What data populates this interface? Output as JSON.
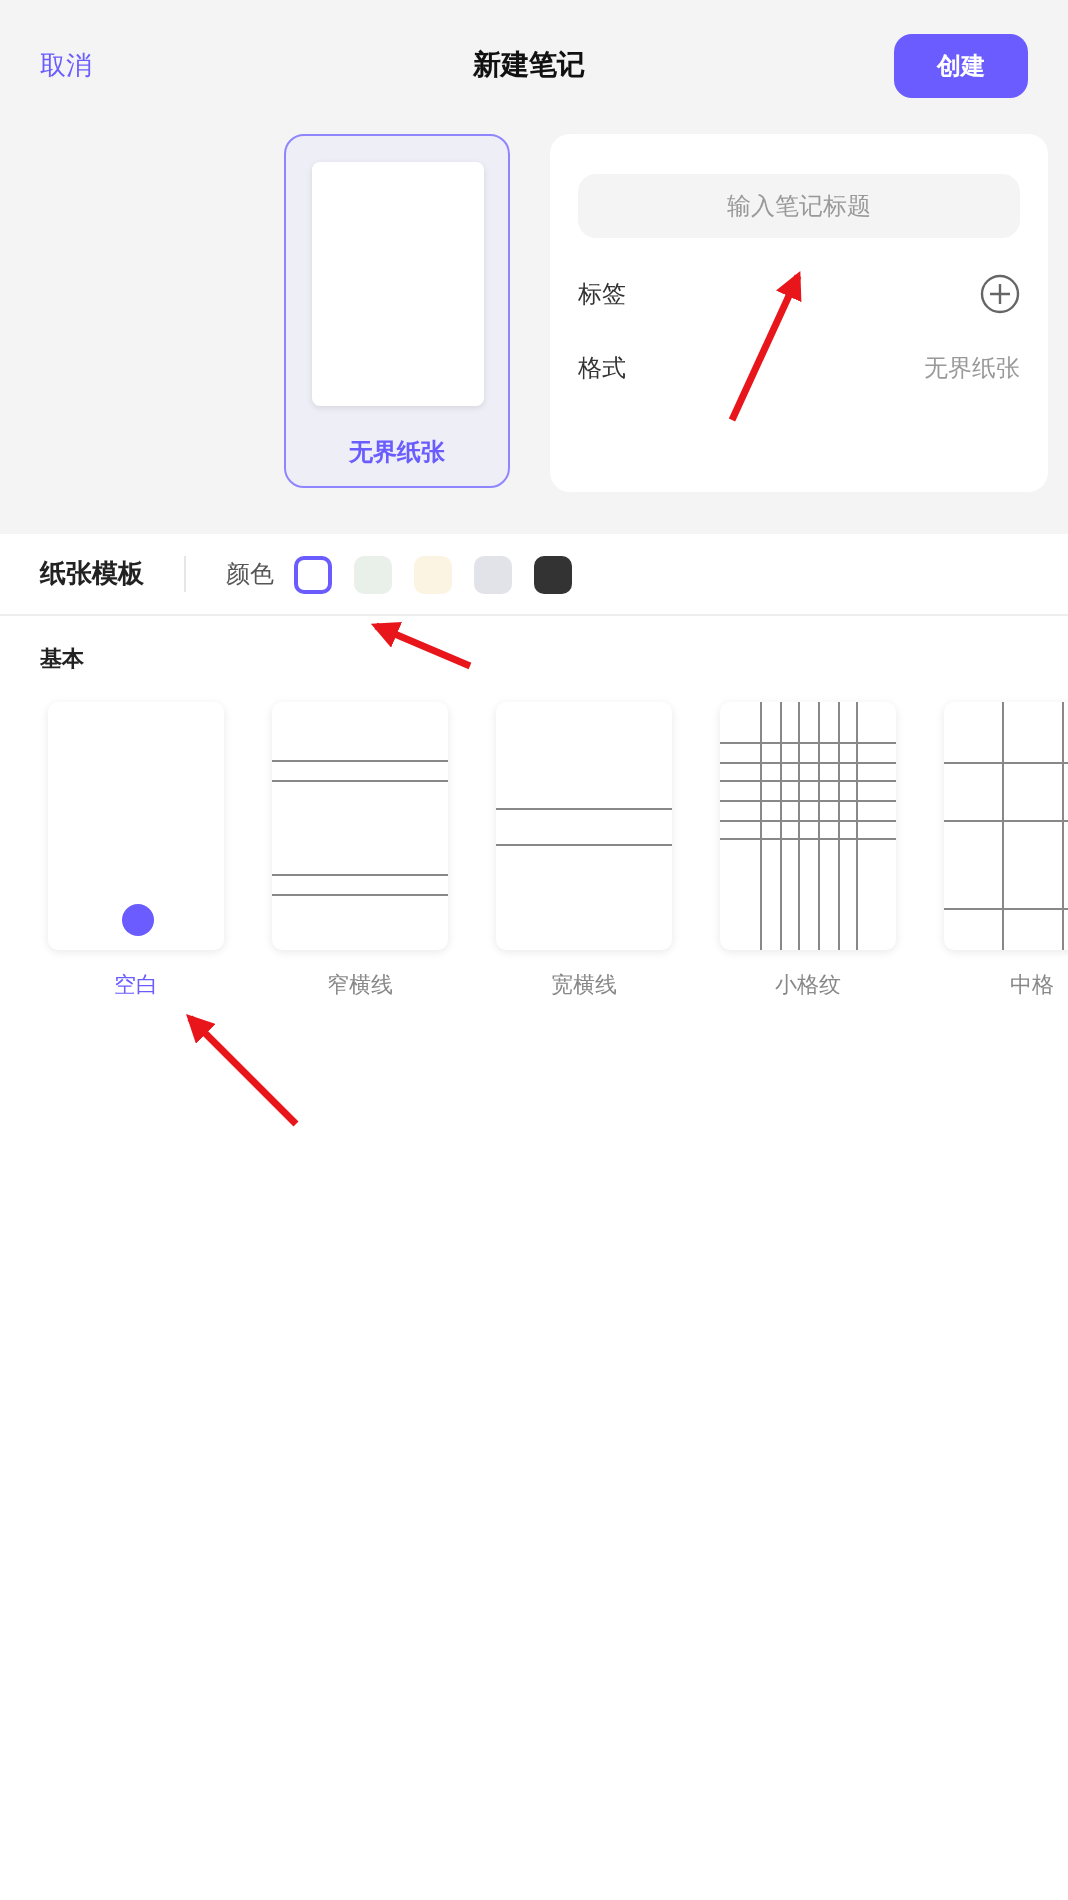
{
  "header": {
    "cancel": "取消",
    "title": "新建笔记",
    "create": "创建"
  },
  "preview": {
    "label": "无界纸张"
  },
  "form": {
    "title_placeholder": "输入笔记标题",
    "tag_label": "标签",
    "format_label": "格式",
    "format_value": "无界纸张"
  },
  "template_bar": {
    "title": "纸张模板",
    "color_label": "颜色"
  },
  "colors": [
    {
      "color": "#ffffff",
      "selected": true
    },
    {
      "color": "#e9efe9",
      "selected": false
    },
    {
      "color": "#fbf4e3",
      "selected": false
    },
    {
      "color": "#e2e3e9",
      "selected": false
    },
    {
      "color": "#333333",
      "selected": false
    }
  ],
  "section": "基本",
  "templates": [
    {
      "kind": "blank",
      "label": "空白",
      "selected": true
    },
    {
      "kind": "narrow",
      "label": "窄横线",
      "selected": false
    },
    {
      "kind": "wide",
      "label": "宽横线",
      "selected": false
    },
    {
      "kind": "small-grid",
      "label": "小格纹",
      "selected": false
    },
    {
      "kind": "medium-grid",
      "label": "中格",
      "selected": false
    }
  ]
}
